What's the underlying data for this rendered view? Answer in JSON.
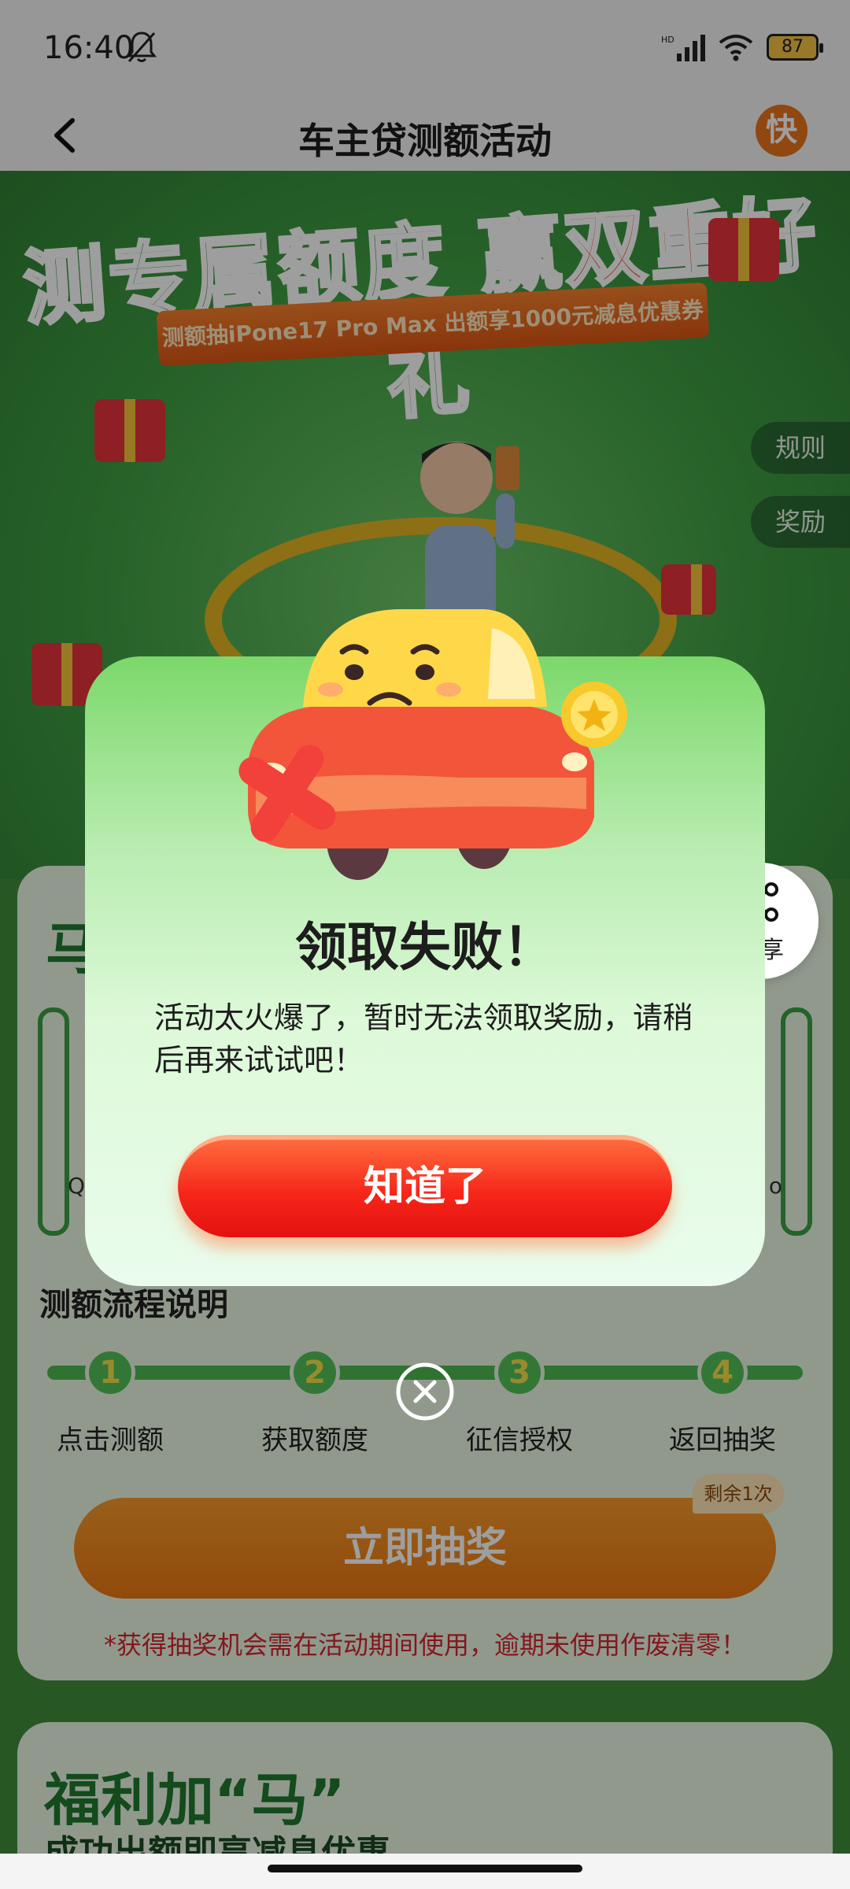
{
  "status_bar": {
    "time": "16:40",
    "battery": "87"
  },
  "nav": {
    "title": "车主贷测额活动",
    "logo_text": "快"
  },
  "hero": {
    "headline_part1": "测专属额度 赢",
    "headline_accent": "双重",
    "headline_part2": "好礼",
    "ribbon": "测额抽iPone17 Pro Max  出额享1000元减息优惠券"
  },
  "side_tabs": {
    "rules": "规则",
    "rewards": "奖励"
  },
  "share": {
    "label": "分享"
  },
  "main_card": {
    "title_partial": "马",
    "left_letter": "Q",
    "right_letter": "o"
  },
  "process": {
    "title": "测额流程说明",
    "steps": [
      {
        "num": "1",
        "label": "点击测额"
      },
      {
        "num": "2",
        "label": "获取额度"
      },
      {
        "num": "3",
        "label": "征信授权"
      },
      {
        "num": "4",
        "label": "返回抽奖"
      }
    ]
  },
  "draw": {
    "button_label": "立即抽奖",
    "remaining_badge": "剩余1次",
    "note": "*获得抽奖机会需在活动期间使用，逾期未使用作废清零！"
  },
  "welfare": {
    "title": "福利加“马”",
    "subtitle": "成功出额即享减息优惠"
  },
  "dialog": {
    "title": "领取失败！",
    "message": "活动太火爆了，暂时无法领取奖励，请稍后再来试试吧！",
    "button_label": "知道了"
  },
  "colors": {
    "brand_green": "#1f7a2e",
    "dialog_button_red": "#f6261a",
    "draw_button_orange": "#ec7712",
    "note_red": "#d4262e"
  },
  "icons": [
    "bell-off-icon",
    "signal-icon",
    "wifi-icon",
    "battery-icon",
    "back-icon",
    "share-icon",
    "close-circle-icon"
  ]
}
